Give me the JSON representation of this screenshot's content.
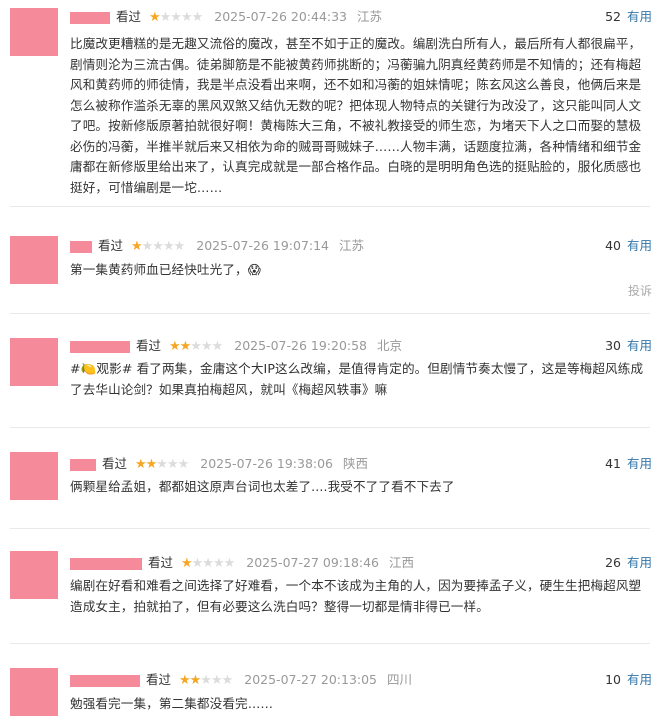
{
  "reviews": [
    {
      "status": "看过",
      "stars": 1,
      "time": "2025-07-26 20:44:33",
      "location": "江苏",
      "votes": "52",
      "useful_label": "有用",
      "content": "比魔改更糟糕的是无趣又流俗的魔改，甚至不如于正的魔改。编剧洗白所有人，最后所有人都很扁平，剧情则沦为三流古偶。徒弟脚筋是不能被黄药师挑断的；冯蘅骗九阴真经黄药师是不知情的；还有梅超风和黄药师的师徒情，我是半点没看出来啊，还不如和冯蘅的姐妹情呢；陈玄风这么善良，他俩后来是怎么被称作滥杀无辜的黑风双煞又结仇无数的呢？把体现人物特点的关键行为改没了，这只能叫同人文了吧。按新修版原著拍就很好啊！黄梅陈大三角，不被礼教接受的师生恋，为堵天下人之口而娶的慧极必伤的冯蘅，半推半就后来又相依为命的贼哥哥贼妹子……人物丰满，话题度拉满，各种情绪和细节金庸都在新修版里给出来了，认真完成就是一部合格作品。白晓的是明明角色选的挺贴脸的，服化质感也挺好，可惜编剧是一坨……"
    },
    {
      "status": "看过",
      "stars": 1,
      "time": "2025-07-26 19:07:14",
      "location": "江苏",
      "votes": "40",
      "useful_label": "有用",
      "content": "第一集黄药师血已经快吐光了，😱",
      "report_label": "投诉"
    },
    {
      "status": "看过",
      "stars": 2,
      "time": "2025-07-26 19:20:58",
      "location": "北京",
      "votes": "30",
      "useful_label": "有用",
      "content": "#🍋观影# 看了两集，金庸这个大IP这么改编，是值得肯定的。但剧情节奏太慢了，这是等梅超风练成了去华山论剑？如果真拍梅超风，就叫《梅超风轶事》嘛"
    },
    {
      "status": "看过",
      "stars": 2,
      "time": "2025-07-26 19:38:06",
      "location": "陕西",
      "votes": "41",
      "useful_label": "有用",
      "content": "俩颗星给孟姐，都都姐这原声台词也太差了....我受不了了看不下去了"
    },
    {
      "status": "看过",
      "stars": 1,
      "time": "2025-07-27 09:18:46",
      "location": "江西",
      "votes": "26",
      "useful_label": "有用",
      "content": "编剧在好看和难看之间选择了好难看，一个本不该成为主角的人，因为要捧孟子义，硬生生把梅超风塑造成女主，拍就拍了，但有必要这么洗白吗？整得一切都是情非得已一样。"
    },
    {
      "status": "看过",
      "stars": 2,
      "time": "2025-07-27 20:13:05",
      "location": "四川",
      "votes": "10",
      "useful_label": "有用",
      "content": "勉强看完一集，第二集都没看完……"
    }
  ]
}
